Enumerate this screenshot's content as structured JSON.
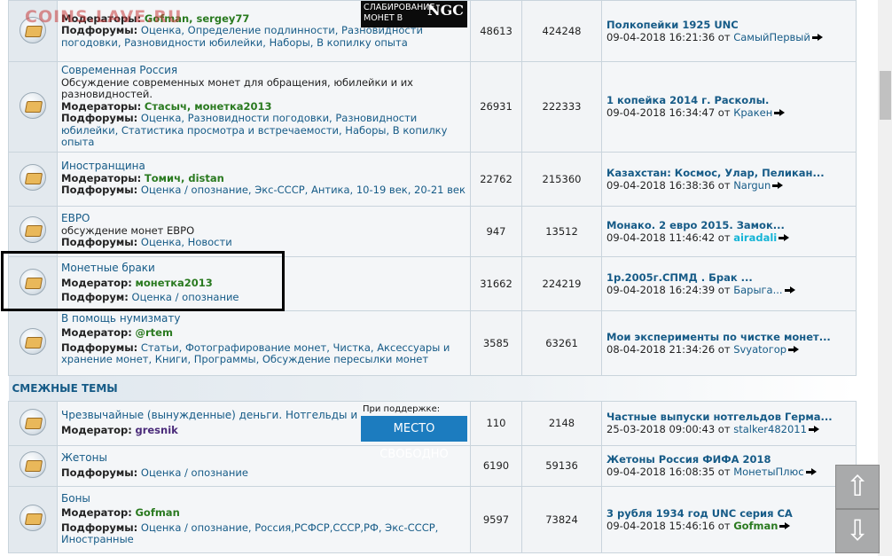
{
  "logo_text": "COINS.LAVE.RU",
  "ad_top": {
    "line1": "СЛАБИРОВАНИЕ",
    "line2": "МОНЕТ В",
    "brand": "NGC"
  },
  "ad_bottom": {
    "label": "При поддержке:",
    "text": "МЕСТО СВОБОДНО"
  },
  "section_title": "СМЕЖНЫЕ ТЕМЫ",
  "go_icon": "go-to-post-icon",
  "forums": [
    {
      "title": "",
      "desc": "",
      "mod_label": "Модераторы:",
      "mods": "Gofman, sergey77",
      "sub_label": "Подфорумы:",
      "subs": "Оценка, Определение подлинности, Разновидности погодовки, Разновидности юбилейки, Наборы, В копилку опыта",
      "topics": "48613",
      "posts": "424248",
      "last_title": "Полкопейки 1925 UNC",
      "last_date": "09-04-2018 16:21:36",
      "last_by": "от",
      "last_author": "СамыйПервый"
    },
    {
      "title": "Современная Россия",
      "desc": "Обсуждение современных монет для обращения, юбилейки и их разновидностей.",
      "mod_label": "Модераторы:",
      "mods": "Стасыч, монетка2013",
      "sub_label": "Подфорумы:",
      "subs": "Оценка, Разновидности погодовки, Разновидности юбилейки, Статистика просмотра и встречаемости, Наборы, В копилку опыта",
      "topics": "26931",
      "posts": "222333",
      "last_title": "1 копейка 2014 г. Расколы.",
      "last_date": "09-04-2018 16:34:47",
      "last_by": "от",
      "last_author": "Кракен"
    },
    {
      "title": "Иностранщина",
      "desc": "",
      "mod_label": "Модераторы:",
      "mods": "Томич, distan",
      "sub_label": "Подфорумы:",
      "subs": "Оценка / опознание, Экс-СССР, Антика, 10-19 век, 20-21 век",
      "topics": "22762",
      "posts": "215360",
      "last_title": "Казахстан: Космос, Улар, Пеликан...",
      "last_date": "09-04-2018 16:38:36",
      "last_by": "от",
      "last_author": "Nargun"
    },
    {
      "title": "ЕВРО",
      "desc": "обсуждение монет ЕВРО",
      "mod_label": "",
      "mods": "",
      "sub_label": "Подфорумы:",
      "subs": "Оценка, Новости",
      "topics": "947",
      "posts": "13512",
      "last_title": "Монако. 2 евро 2015. Замок...",
      "last_date": "09-04-2018 11:46:42",
      "last_by": "от",
      "last_author": "airadali"
    },
    {
      "title": "Монетные браки",
      "desc": "",
      "mod_label": "Модератор:",
      "mods": "монетка2013",
      "sub_label": "Подфорум:",
      "subs": "Оценка / опознание",
      "topics": "31662",
      "posts": "224219",
      "last_title": "1р.2005г.СПМД . Брак ...",
      "last_date": "09-04-2018 16:24:39",
      "last_by": "от",
      "last_author": "Барыга..."
    },
    {
      "title": "В помощь нумизмату",
      "desc": "",
      "mod_label": "Модератор:",
      "mods": "@rtem",
      "sub_label": "Подфорумы:",
      "subs": "Статьи, Фотографирование монет, Чистка, Аксессуары и хранение монет, Книги, Программы, Обсуждение пересылки монет",
      "topics": "3585",
      "posts": "63261",
      "last_title": "Мои эксперименты по чистке монет...",
      "last_date": "08-04-2018 21:34:26",
      "last_by": "от",
      "last_author": "Svyatогор"
    }
  ],
  "related": [
    {
      "title": "Чрезвычайные (вынужденные) деньги. Нотгельды и пр",
      "mod_label": "Модератор:",
      "mods": "gresnik",
      "sub_label": "",
      "subs": "",
      "topics": "110",
      "posts": "2148",
      "last_title": "Частные выпуски нотгельдов Герма...",
      "last_date": "25-03-2018 09:00:43",
      "last_by": "от",
      "last_author": "stalker482011"
    },
    {
      "title": "Жетоны",
      "mod_label": "",
      "mods": "",
      "sub_label": "Подфорумы:",
      "subs": "Оценка / опознание",
      "topics": "6190",
      "posts": "59136",
      "last_title": "Жетоны Россия ФИФА 2018",
      "last_date": "09-04-2018 16:08:35",
      "last_by": "от",
      "last_author": "МонетыПлюс"
    },
    {
      "title": "Боны",
      "mod_label": "Модератор:",
      "mods": "Gofman",
      "sub_label": "Подфорумы:",
      "subs": "Оценка / опознание, Россия,РСФСР,СССР,РФ, Экс-СССР, Иностранные",
      "topics": "9597",
      "posts": "73824",
      "last_title": "3 рубля 1934 год UNC серия СА",
      "last_date": "09-04-2018 15:46:16",
      "last_by": "от",
      "last_author": "Gofman"
    }
  ],
  "nav": {
    "up": "⇧",
    "down": "⇩"
  }
}
